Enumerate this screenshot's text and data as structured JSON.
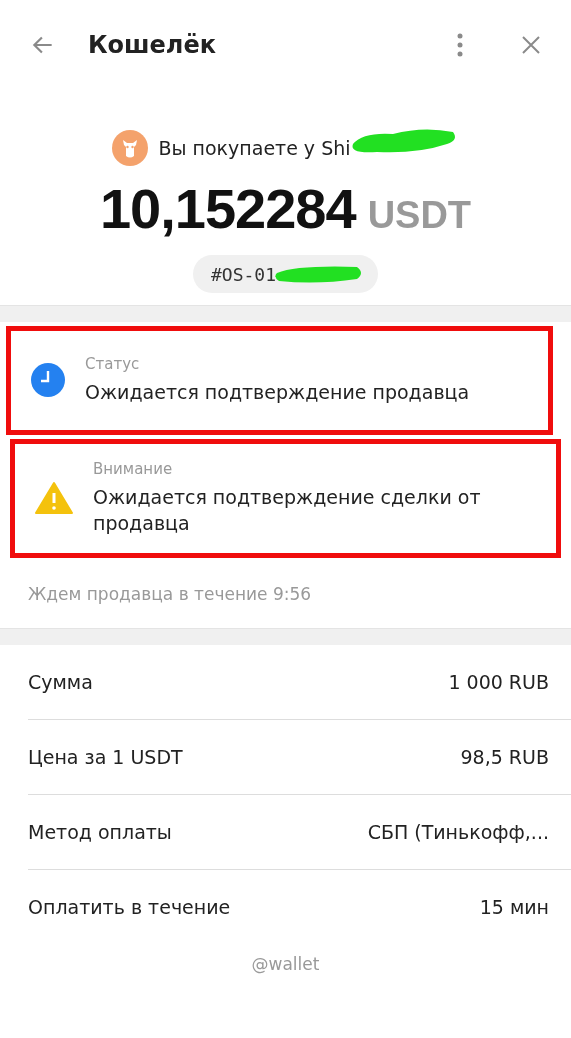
{
  "header": {
    "title": "Кошелёк"
  },
  "purchase": {
    "seller_text": "Вы покупаете у Shi",
    "seller_redacted": true,
    "amount": "10,152284",
    "currency": "USDT",
    "order_id": "#OS-01",
    "order_redacted": true
  },
  "notices": [
    {
      "kind": "status",
      "label": "Статус",
      "text": "Ожидается подтверждение продавца",
      "highlighted": true
    },
    {
      "kind": "warning",
      "label": "Внимание",
      "text": "Ожидается подтверждение сделки от продавца",
      "highlighted": true
    }
  ],
  "wait_text": "Ждем продавца в течение 9:56",
  "details": [
    {
      "label": "Сумма",
      "value": "1 000 RUB"
    },
    {
      "label": "Цена за 1 USDT",
      "value": "98,5 RUB"
    },
    {
      "label": "Метод оплаты",
      "value": "СБП (Тинькофф,..."
    },
    {
      "label": "Оплатить в течение",
      "value": "15 мин"
    }
  ],
  "footer": "@wallet"
}
